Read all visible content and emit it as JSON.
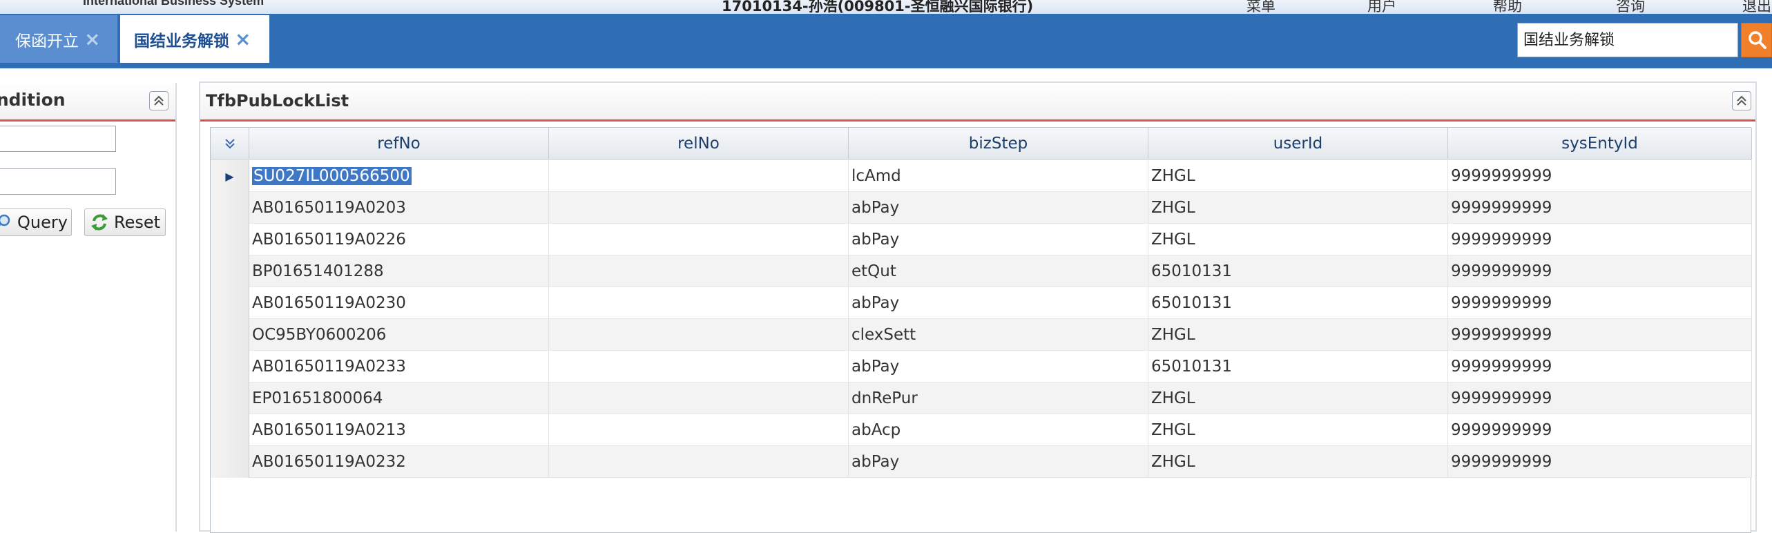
{
  "header": {
    "system_name": "International Business System",
    "user_info": "17010134-孙浩(009801-圣恒融兴国际银行)",
    "menu": [
      "菜单",
      "用户",
      "帮助",
      "咨询",
      "退出"
    ]
  },
  "tabs": [
    {
      "label": "保函开立",
      "close": "×"
    },
    {
      "label": "国结业务解锁",
      "close": "×"
    }
  ],
  "search": {
    "value": "国结业务解锁",
    "icon": "search-icon"
  },
  "query_panel": {
    "title": "ry Condition",
    "query_label": "Query",
    "reset_label": "Reset",
    "query_icon": "magnifier-icon",
    "reset_icon": "refresh-icon"
  },
  "grid_panel": {
    "title": "TfbPubLockList",
    "columns": [
      "refNo",
      "relNo",
      "bizStep",
      "userId",
      "sysEntyId"
    ],
    "rows": [
      {
        "refNo": "SU027IL000566500",
        "relNo": "",
        "bizStep": "lcAmd",
        "userId": "ZHGL",
        "sysEntyId": "9999999999"
      },
      {
        "refNo": "AB01650119A0203",
        "relNo": "",
        "bizStep": "abPay",
        "userId": "ZHGL",
        "sysEntyId": "9999999999"
      },
      {
        "refNo": "AB01650119A0226",
        "relNo": "",
        "bizStep": "abPay",
        "userId": "ZHGL",
        "sysEntyId": "9999999999"
      },
      {
        "refNo": "BP01651401288",
        "relNo": "",
        "bizStep": "etQut",
        "userId": "65010131",
        "sysEntyId": "9999999999"
      },
      {
        "refNo": "AB01650119A0230",
        "relNo": "",
        "bizStep": "abPay",
        "userId": "65010131",
        "sysEntyId": "9999999999"
      },
      {
        "refNo": "OC95BY0600206",
        "relNo": "",
        "bizStep": "clexSett",
        "userId": "ZHGL",
        "sysEntyId": "9999999999"
      },
      {
        "refNo": "AB01650119A0233",
        "relNo": "",
        "bizStep": "abPay",
        "userId": "65010131",
        "sysEntyId": "9999999999"
      },
      {
        "refNo": "EP01651800064",
        "relNo": "",
        "bizStep": "dnRePur",
        "userId": "ZHGL",
        "sysEntyId": "9999999999"
      },
      {
        "refNo": "AB01650119A0213",
        "relNo": "",
        "bizStep": "abAcp",
        "userId": "ZHGL",
        "sysEntyId": "9999999999"
      },
      {
        "refNo": "AB01650119A0232",
        "relNo": "",
        "bizStep": "abPay",
        "userId": "ZHGL",
        "sysEntyId": "9999999999"
      }
    ],
    "selected_row": 0
  },
  "colors": {
    "tabbar": "#2f6db5",
    "accent_red": "#d9534f",
    "search_button": "#f0802a",
    "selection": "#3f77c7"
  }
}
